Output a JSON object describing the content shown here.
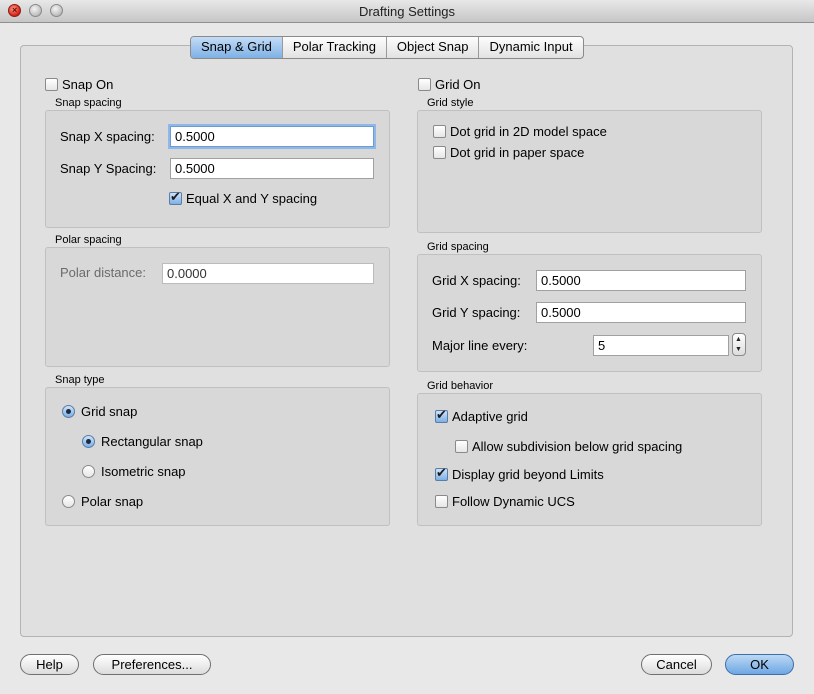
{
  "window": {
    "title": "Drafting Settings"
  },
  "tabs": [
    {
      "label": "Snap & Grid",
      "active": true
    },
    {
      "label": "Polar Tracking",
      "active": false
    },
    {
      "label": "Object Snap",
      "active": false
    },
    {
      "label": "Dynamic Input",
      "active": false
    }
  ],
  "snap": {
    "on_label": "Snap On",
    "on": false,
    "spacing_title": "Snap spacing",
    "x_label": "Snap X spacing:",
    "x_value": "0.5000",
    "y_label": "Snap Y Spacing:",
    "y_value": "0.5000",
    "equal_label": "Equal X and Y spacing",
    "equal": true
  },
  "polar": {
    "title": "Polar spacing",
    "distance_label": "Polar distance:",
    "distance_value": "0.0000"
  },
  "snap_type": {
    "title": "Snap type",
    "grid_snap": "Grid snap",
    "rectangular": "Rectangular snap",
    "isometric": "Isometric snap",
    "polar": "Polar snap",
    "selected": "grid_snap",
    "selected_sub": "rectangular"
  },
  "grid": {
    "on_label": "Grid On",
    "on": false,
    "style_title": "Grid style",
    "dot_model": "Dot grid in 2D model space",
    "dot_model_checked": false,
    "dot_paper": "Dot grid in paper space",
    "dot_paper_checked": false,
    "spacing_title": "Grid spacing",
    "x_label": "Grid X spacing:",
    "x_value": "0.5000",
    "y_label": "Grid Y spacing:",
    "y_value": "0.5000",
    "major_label": "Major line every:",
    "major_value": "5",
    "behavior_title": "Grid behavior",
    "adaptive": "Adaptive grid",
    "adaptive_checked": true,
    "subdivision": "Allow subdivision below grid spacing",
    "subdivision_checked": false,
    "beyond": "Display grid beyond Limits",
    "beyond_checked": true,
    "follow_ucs": "Follow Dynamic UCS",
    "follow_ucs_checked": false
  },
  "buttons": {
    "help": "Help",
    "preferences": "Preferences...",
    "cancel": "Cancel",
    "ok": "OK"
  }
}
